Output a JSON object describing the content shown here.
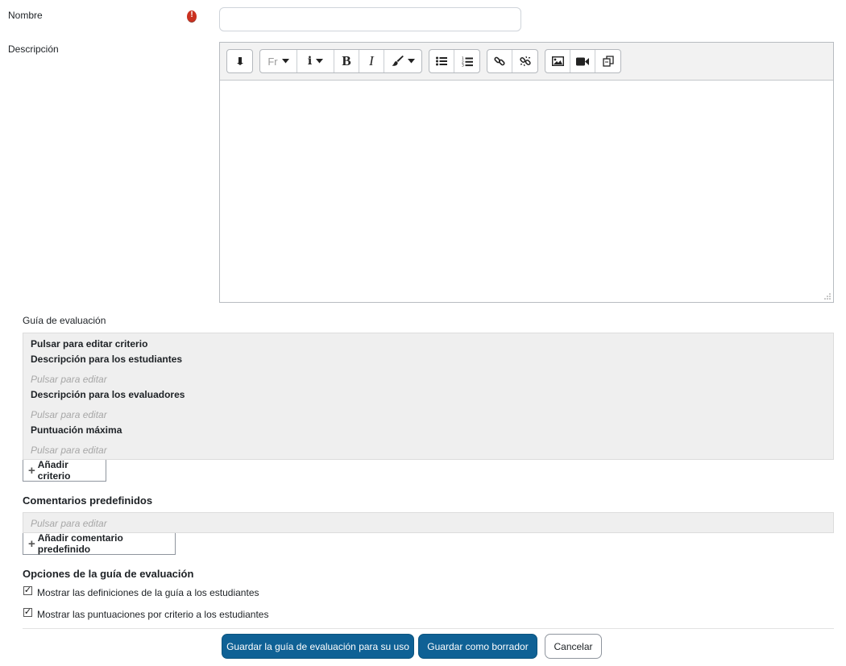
{
  "form": {
    "name_label": "Nombre",
    "name_value": "",
    "required_icon": "exclamation-circle-icon",
    "description_label": "Descripción"
  },
  "editor": {
    "toolbar_icons": [
      "collapse-arrow-icon",
      "font-family-icon",
      "info-icon",
      "bold-icon",
      "italic-icon",
      "brush-icon",
      "unordered-list-icon",
      "ordered-list-icon",
      "link-icon",
      "unlink-icon",
      "image-icon",
      "video-icon",
      "copy-icon"
    ],
    "font_button": "Fr",
    "bold_button": "B",
    "italic_button": "I",
    "info_button": "i",
    "content": ""
  },
  "guide": {
    "title": "Guía de evaluación",
    "criterion_edit": "Pulsar para editar criterio",
    "student_desc_label": "Descripción para los estudiantes",
    "student_desc_hint": "Pulsar para editar",
    "marker_desc_label": "Descripción para los evaluadores",
    "marker_desc_hint": "Pulsar para editar",
    "max_score_label": "Puntuación máxima",
    "max_score_hint": "Pulsar para editar",
    "add_criterion": "Añadir criterio"
  },
  "comments": {
    "title": "Comentarios predefinidos",
    "hint": "Pulsar para editar",
    "add_comment": "Añadir comentario predefinido"
  },
  "options": {
    "title": "Opciones de la guía de evaluación",
    "show_definitions": "Mostrar las definiciones de la guía a los estudiantes",
    "show_definitions_checked": true,
    "show_scores": "Mostrar las puntuaciones por criterio a los estudiantes",
    "show_scores_checked": true
  },
  "actions": {
    "save_use": "Guardar la guía de evaluación para su uso",
    "save_draft": "Guardar como borrador",
    "cancel": "Cancelar"
  },
  "colors": {
    "primary": "#0f6195",
    "required": "#ca3120",
    "grey_panel": "#efefef"
  }
}
